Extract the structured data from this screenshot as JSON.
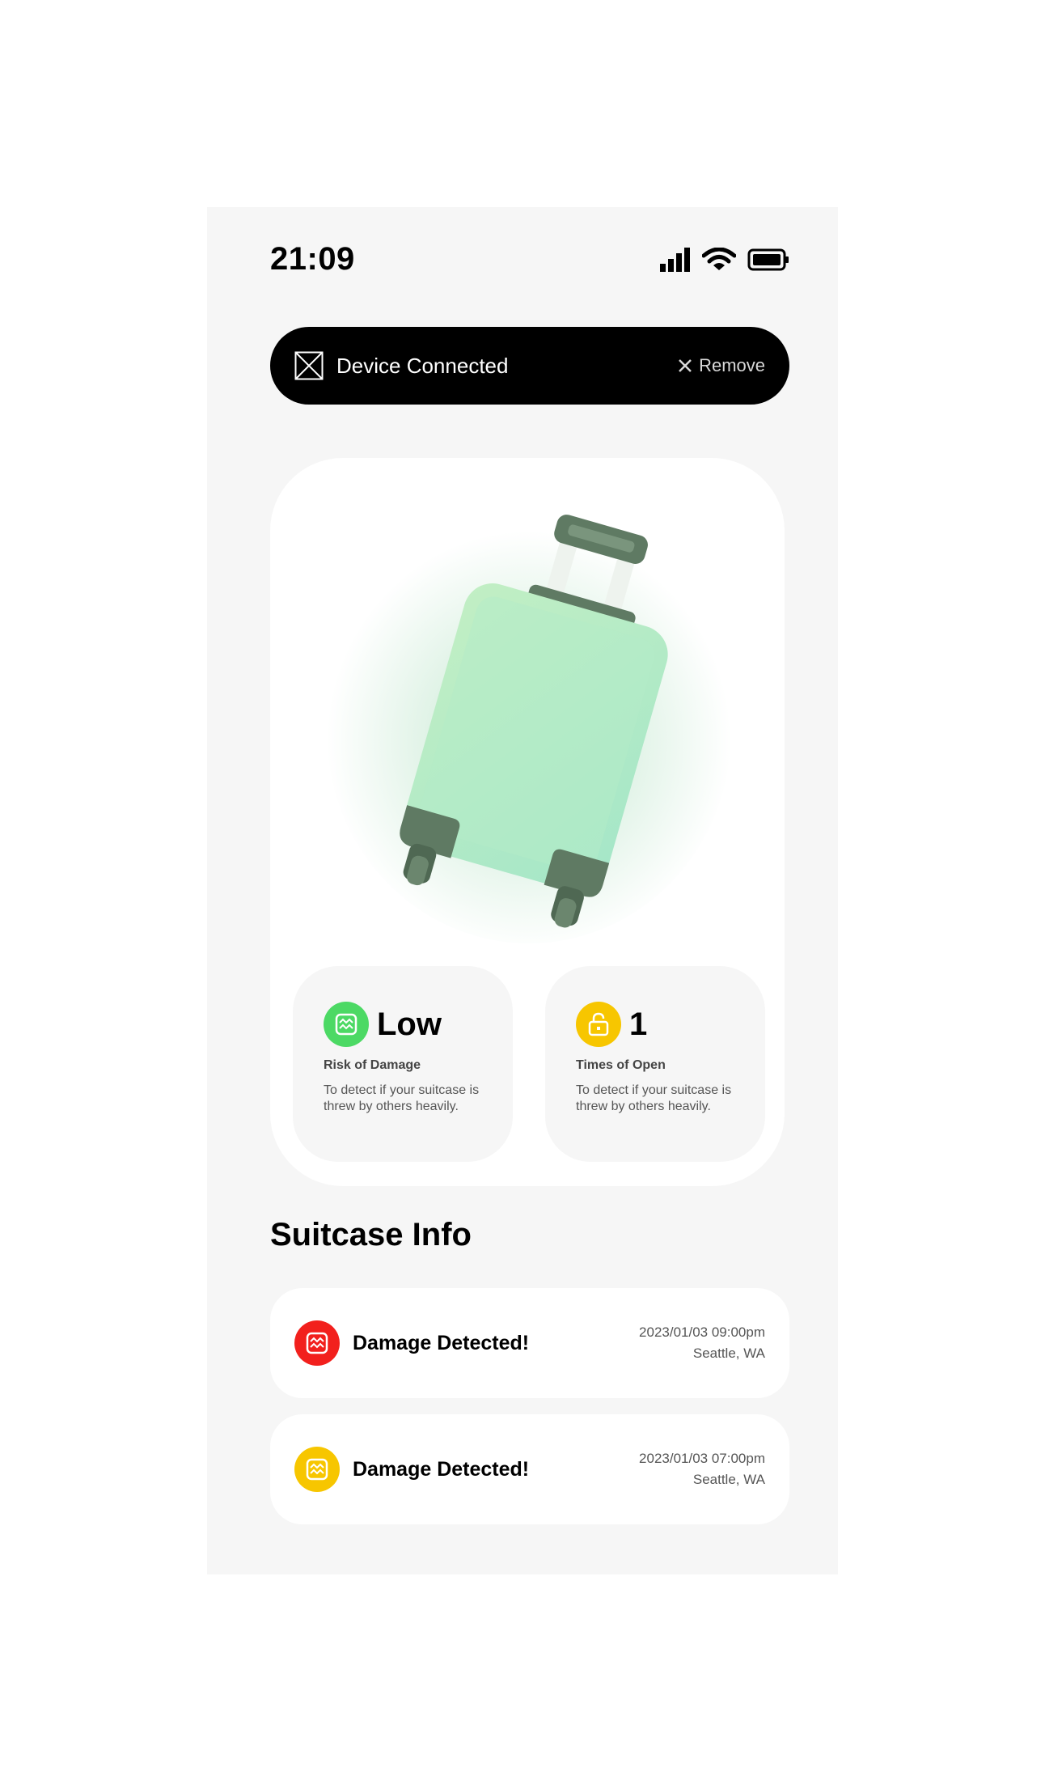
{
  "status_bar": {
    "time": "21:09"
  },
  "banner": {
    "title": "Device Connected",
    "remove_label": "Remove"
  },
  "stats": [
    {
      "value": "Low",
      "label": "Risk of Damage",
      "description": "To detect if your suitcase is threw by others heavily.",
      "badge_color": "#4cd964",
      "icon": "damage-wave-icon"
    },
    {
      "value": "1",
      "label": "Times of Open",
      "description": "To detect if your suitcase is threw by others heavily.",
      "badge_color": "#f7c600",
      "icon": "unlock-icon"
    }
  ],
  "section": {
    "title": "Suitcase Info"
  },
  "events": [
    {
      "title": "Damage Detected!",
      "datetime": "2023/01/03 09:00pm",
      "location": "Seattle, WA",
      "color": "#f2201d"
    },
    {
      "title": "Damage Detected!",
      "datetime": "2023/01/03 07:00pm",
      "location": "Seattle, WA",
      "color": "#f7c600"
    }
  ],
  "colors": {
    "banner_bg": "#000000",
    "suitcase": "#aee8c4",
    "suitcase_trim": "#5f7a63"
  }
}
